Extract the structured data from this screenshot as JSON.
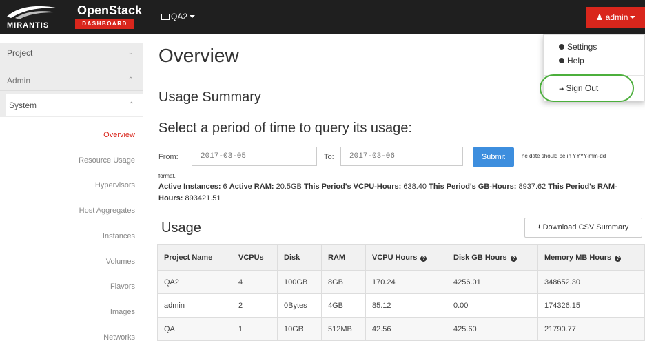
{
  "brand": {
    "line1": "OpenStack",
    "line2": "DASHBOARD",
    "company": "MIRANTIS"
  },
  "topnav": {
    "project": "QA2",
    "user": "admin"
  },
  "user_menu": {
    "items": [
      "Settings",
      "Help",
      "Sign Out"
    ]
  },
  "sidebar": {
    "project": "Project",
    "admin": "Admin",
    "system": "System",
    "links": [
      "Overview",
      "Resource Usage",
      "Hypervisors",
      "Host Aggregates",
      "Instances",
      "Volumes",
      "Flavors",
      "Images",
      "Networks"
    ]
  },
  "main": {
    "title": "Overview",
    "usage_summary": "Usage Summary",
    "period_heading": "Select a period of time to query its usage:",
    "from_label": "From:",
    "from_value": "2017-03-05",
    "to_label": "To:",
    "to_value": "2017-03-06",
    "submit": "Submit",
    "hint": "The date should be in YYYY-mm-dd",
    "hint2": "format.",
    "stats": {
      "active_instances_label": "Active Instances:",
      "active_instances": "6",
      "active_ram_label": "Active RAM:",
      "active_ram": "20.5GB",
      "vcpu_hours_label": "This Period's VCPU-Hours:",
      "vcpu_hours": "638.40",
      "gb_hours_label": "This Period's GB-Hours:",
      "gb_hours": "8937.62",
      "ram_hours_label": "This Period's RAM-Hours:",
      "ram_hours": "893421.51"
    },
    "usage": "Usage",
    "csv": "Download CSV Summary",
    "table": {
      "headers": [
        "Project Name",
        "VCPUs",
        "Disk",
        "RAM",
        "VCPU Hours",
        "Disk GB Hours",
        "Memory MB Hours"
      ],
      "rows": [
        [
          "QA2",
          "4",
          "100GB",
          "8GB",
          "170.24",
          "4256.01",
          "348652.30"
        ],
        [
          "admin",
          "2",
          "0Bytes",
          "4GB",
          "85.12",
          "0.00",
          "174326.15"
        ],
        [
          "QA",
          "1",
          "10GB",
          "512MB",
          "42.56",
          "425.60",
          "21790.77"
        ]
      ]
    }
  }
}
